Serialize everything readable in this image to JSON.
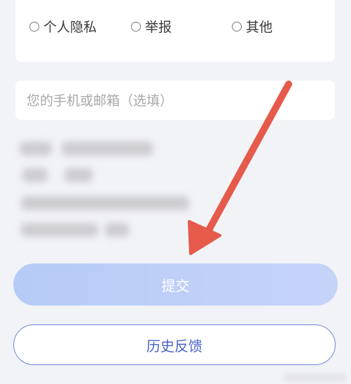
{
  "report_type": {
    "options": [
      {
        "label": "个人隐私",
        "selected": false
      },
      {
        "label": "举报",
        "selected": false
      },
      {
        "label": "其他",
        "selected": false
      }
    ]
  },
  "contact": {
    "placeholder": "您的手机或邮箱（选填）",
    "value": ""
  },
  "actions": {
    "submit_label": "提交",
    "history_label": "历史反馈"
  },
  "colors": {
    "submit_gradient_start": "#b6cbf7",
    "submit_gradient_end": "#c6d3f9",
    "history_border": "#6f86d6",
    "history_text": "#4a63c9",
    "annotation_arrow": "#e55a4a"
  },
  "annotation": {
    "icon": "red-arrow-pointing-to-submit"
  }
}
